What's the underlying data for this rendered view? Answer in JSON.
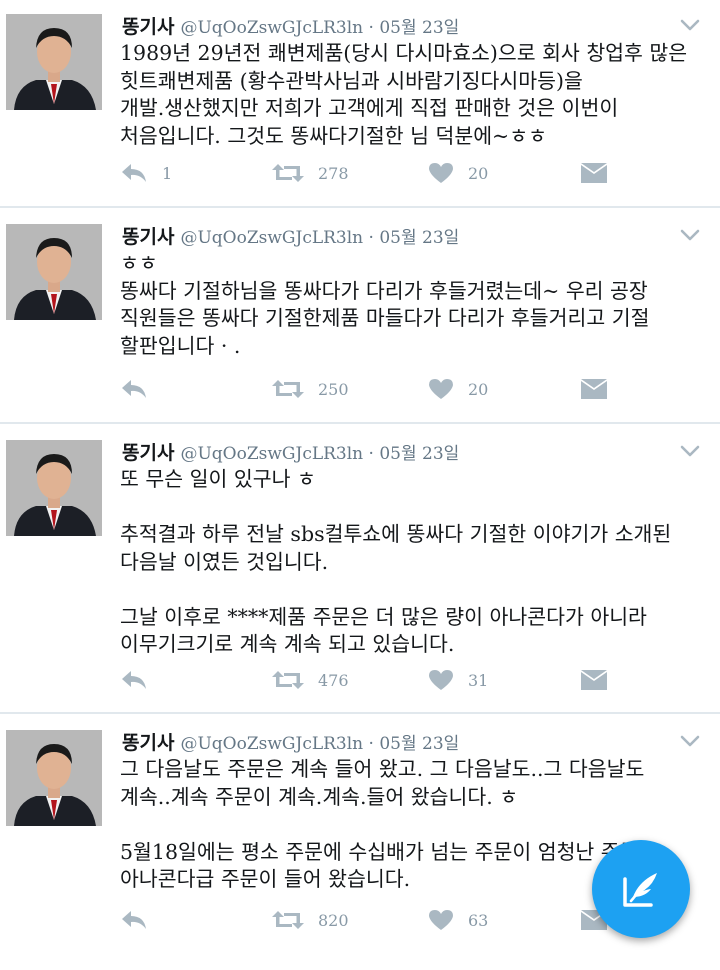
{
  "tweets": [
    {
      "name": "똥기사",
      "meta": "@UqOoZswGJcLR3ln · 05월 23일",
      "lines": [
        "1989년 29년전 쾌변제품(당시 다시마효소)으로 회사 창업후 많은",
        "힛트쾌변제품 (황수관박사님과 시바람기징다시마등)을",
        "개발.생산했지만 저희가 고객에게 직접 판매한 것은  이번이",
        "처음입니다. 그것도 똥싸다기절한 님 덕분에~ㅎㅎ"
      ],
      "replies": "1",
      "retweets": "278",
      "likes": "20"
    },
    {
      "name": "똥기사",
      "meta": "@UqOoZswGJcLR3ln · 05월 23일",
      "lines": [
        "ㅎㅎ",
        "똥싸다 기절하님을  똥싸다가 다리가 후들거렸는데~ 우리 공장",
        "직원들은 똥싸다 기절한제품 마들다가 다리가 후들거리고 기절",
        "할판입니다 · ."
      ],
      "replies": "",
      "retweets": "250",
      "likes": "20"
    },
    {
      "name": "똥기사",
      "meta": "@UqOoZswGJcLR3ln · 05월 23일",
      "lines": [
        "또 무슨 일이 있구나 ㅎ",
        "",
        "추적결과 하루 전날 sbs컬투쇼에 똥싸다 기절한 이야기가 소개된",
        "다음날 이였든 것입니다.",
        "",
        "그날 이후로 ****제품 주문은 더 많은 량이 아나콘다가 아니라",
        "이무기크기로 계속 계속 되고 있습니다."
      ],
      "replies": "",
      "retweets": "476",
      "likes": "31"
    },
    {
      "name": "똥기사",
      "meta": "@UqOoZswGJcLR3ln · 05월 23일",
      "lines": [
        "그 다음날도 주문은 계속 들어 왔고. 그 다음날도..그 다음날도",
        "계속..계속  주문이 계속.계속.들어 왔습니다. ㅎ",
        "",
        "5월18일에는 평소 주문에 수십배가 넘는 주문이 엄청난 주문",
        "아나콘다급 주문이 들어 왔습니다."
      ],
      "replies": "",
      "retweets": "820",
      "likes": "63"
    }
  ],
  "icons": {
    "reply": "reply-icon",
    "retweet": "retweet-icon",
    "like": "heart-icon",
    "dm": "envelope-icon",
    "menu": "chevron-down-icon",
    "compose": "compose-tweet-icon"
  },
  "colors": {
    "accent": "#1da1f2",
    "icon": "#aab8c2",
    "meta": "#657786",
    "divider": "#e1e8ed"
  }
}
